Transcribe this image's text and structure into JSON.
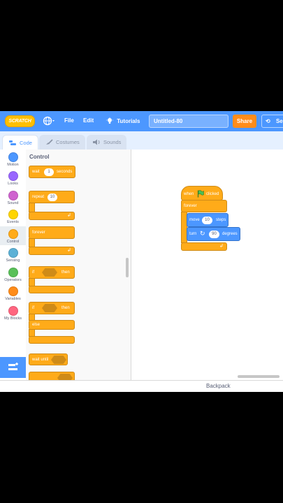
{
  "menubar": {
    "logo": "SCRATCH",
    "file": "File",
    "edit": "Edit",
    "tutorials": "Tutorials",
    "project_title": "Untitled-80",
    "share": "Share",
    "see_project": "Se",
    "color": "#4c97ff"
  },
  "tabs": [
    {
      "label": "Code",
      "icon": "code-icon"
    },
    {
      "label": "Costumes",
      "icon": "brush-icon"
    },
    {
      "label": "Sounds",
      "icon": "speaker-icon"
    }
  ],
  "categories": [
    {
      "label": "Motion",
      "color": "#4c97ff"
    },
    {
      "label": "Looks",
      "color": "#9966ff"
    },
    {
      "label": "Sound",
      "color": "#cf63cf"
    },
    {
      "label": "Events",
      "color": "#ffd500"
    },
    {
      "label": "Control",
      "color": "#ffab19"
    },
    {
      "label": "Sensing",
      "color": "#5cb1d6"
    },
    {
      "label": "Operators",
      "color": "#59c059"
    },
    {
      "label": "Variables",
      "color": "#ff8c1a"
    },
    {
      "label": "My Blocks",
      "color": "#ff6680"
    }
  ],
  "palette": {
    "title": "Control",
    "wait": {
      "pre": "wait",
      "value": "1",
      "post": "seconds"
    },
    "repeat": {
      "label": "repeat",
      "value": "10"
    },
    "forever": "forever",
    "if_then": {
      "if": "if",
      "then": "then"
    },
    "if_else": {
      "if": "if",
      "then": "then",
      "else": "else"
    },
    "wait_until": "wait until"
  },
  "script": {
    "hat": {
      "pre": "when",
      "post": "clicked"
    },
    "forever": "forever",
    "move": {
      "pre": "move",
      "value": "10",
      "post": "steps"
    },
    "turn": {
      "pre": "turn",
      "value": "90",
      "post": "degrees"
    }
  },
  "bottom": {
    "backpack": "Backpack"
  }
}
